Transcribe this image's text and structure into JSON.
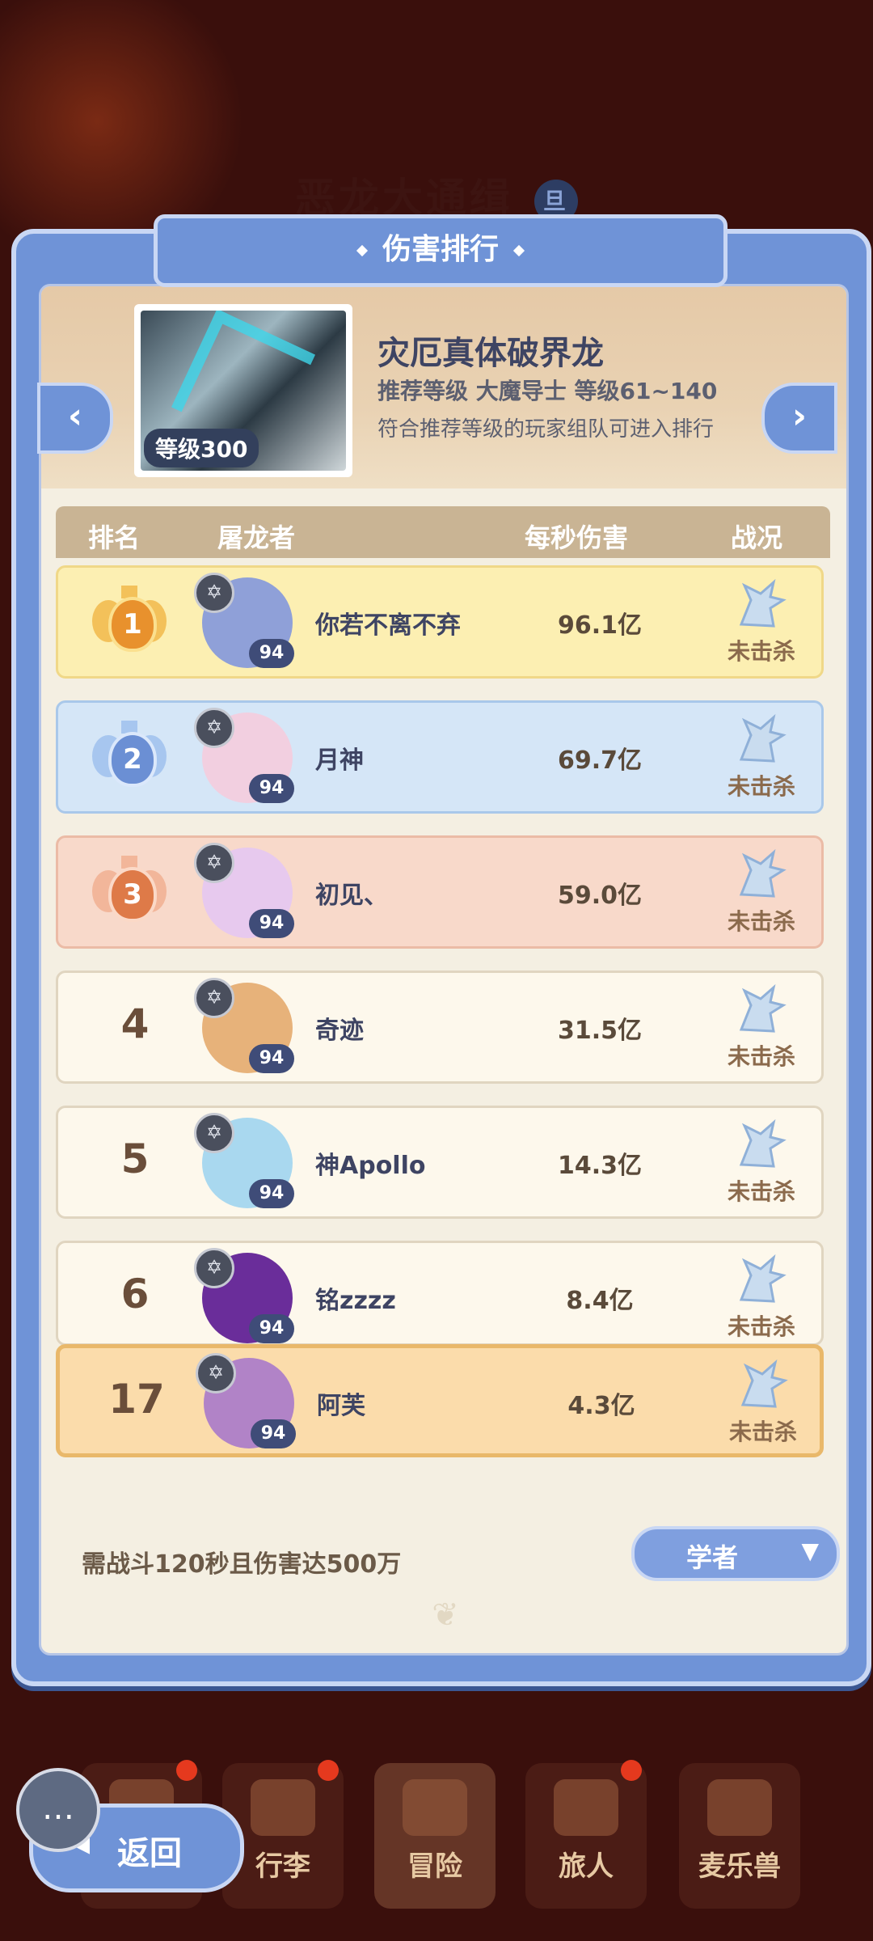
{
  "background_title": "恶龙大通缉",
  "background_badge": "旦",
  "panel_title": "伤害排行",
  "boss": {
    "name": "灾厄真体破界龙",
    "level_badge": "等级300",
    "recommended": "推荐等级 大魔导士 等级61~140",
    "note": "符合推荐等级的玩家组队可进入排行"
  },
  "table_headers": {
    "rank": "排名",
    "player": "屠龙者",
    "dps": "每秒伤害",
    "status": "战况"
  },
  "rows": [
    {
      "rank": "1",
      "name": "你若不离不弃",
      "level": "94",
      "damage": "96.1亿",
      "status": "未击杀",
      "avatar_color": "#8fa0d8"
    },
    {
      "rank": "2",
      "name": "月神",
      "level": "94",
      "damage": "69.7亿",
      "status": "未击杀",
      "avatar_color": "#f2cfe0"
    },
    {
      "rank": "3",
      "name": "初见、",
      "level": "94",
      "damage": "59.0亿",
      "status": "未击杀",
      "avatar_color": "#e7c9ee"
    },
    {
      "rank": "4",
      "name": "奇迹",
      "level": "94",
      "damage": "31.5亿",
      "status": "未击杀",
      "avatar_color": "#e7b27a"
    },
    {
      "rank": "5",
      "name": "神Apollo",
      "level": "94",
      "damage": "14.3亿",
      "status": "未击杀",
      "avatar_color": "#a9d8ef"
    },
    {
      "rank": "6",
      "name": "铭zzzz",
      "level": "94",
      "damage": "8.4亿",
      "status": "未击杀",
      "avatar_color": "#6a2d9a"
    }
  ],
  "my_row": {
    "rank": "17",
    "name": "阿芙",
    "level": "94",
    "damage": "4.3亿",
    "status": "未击杀",
    "avatar_color": "#b183c7"
  },
  "footer_note": "需战斗120秒且伤害达500万",
  "class_filter": "学者",
  "nav": {
    "items": [
      "行李",
      "冒险",
      "旅人",
      "麦乐兽"
    ],
    "back_label": "返回"
  }
}
